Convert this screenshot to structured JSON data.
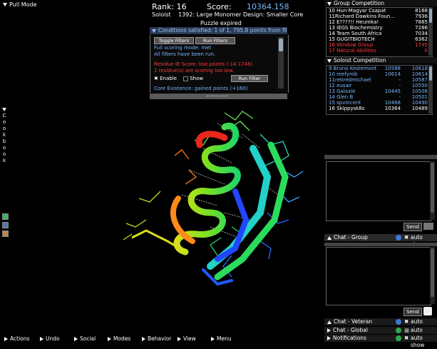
{
  "header": {
    "pull_mode": "Pull Mode",
    "rank_label": "Rank: 16",
    "score_label": "Score:",
    "score_value": "10364.158",
    "mode": "Soloist",
    "puzzle_title": "1392: Large Monomer Design: Smaller Core",
    "status": "Puzzle expired"
  },
  "conditions": {
    "header": "Conditions satisfied: 1 of 1, 795.8 points from filters",
    "toggle_filters": "Toggle Filters",
    "run_filters": "Run Filters",
    "line1": "Full scoring mode: met",
    "line2": "All filters have been run.",
    "line3": "Residue IE Score: lost points (-14.1746)",
    "line4": "1 residue(s) are scoring too low.",
    "enable_label": "Enable",
    "show_label": "Show",
    "run_filter": "Run Filter",
    "core_line": "Core Existence: gained points (+160)"
  },
  "sidebar": {
    "cookbook_letters": [
      "C",
      "o",
      "o",
      "k",
      "b",
      "o",
      "o",
      "k"
    ]
  },
  "group_competition": {
    "title": "Group Competition",
    "rows": [
      {
        "rank": "10 Hun-Magyar Csapat",
        "score": "8168",
        "color": "#ffffff"
      },
      {
        "rank": "11Richard Dawkins Foun...",
        "score": "7936",
        "color": "#ffffff"
      },
      {
        "rank": "12 E????!! Heureka!",
        "score": "7885",
        "color": "#ffffff"
      },
      {
        "rank": "13 IEGS Biochemistry",
        "score": "7286",
        "color": "#ffffff"
      },
      {
        "rank": "14 Team South Africa",
        "score": "7034",
        "color": "#ffffff"
      },
      {
        "rank": "15 GUGITBIOTECH",
        "score": "6362",
        "color": "#ffffff"
      },
      {
        "rank": "16 Window Group",
        "score": "1745",
        "color": "#ff3b3b"
      },
      {
        "rank": "17 Natural Abilities",
        "score": "0",
        "color": "#ff3b3b"
      }
    ]
  },
  "soloist_competition": {
    "title": "Soloist Competition",
    "rows": [
      {
        "rank": "9 Bruno Kestemont",
        "s1": "10588",
        "s2": "10618",
        "color": "#7ab7ff"
      },
      {
        "rank": "10 reefyrob",
        "s1": "10614",
        "s2": "10614",
        "color": "#7ab7ff"
      },
      {
        "rank": "11retiredmichael",
        "s1": "-",
        "s2": "10587",
        "color": "#7ab7ff"
      },
      {
        "rank": "12 eusair",
        "s1": "-",
        "s2": "10550",
        "color": "#7ab7ff"
      },
      {
        "rank": "13 Galaxie",
        "s1": "10445",
        "s2": "10508",
        "color": "#7ab7ff"
      },
      {
        "rank": "14 Glen B",
        "s1": "-",
        "s2": "10501",
        "color": "#7ab7ff"
      },
      {
        "rank": "15 spvincent",
        "s1": "10468",
        "s2": "10490",
        "color": "#7ab7ff"
      },
      {
        "rank": "16 Skippysk8s",
        "s1": "10364",
        "s2": "10489",
        "color": "#ffffff"
      }
    ]
  },
  "chat": {
    "send": "Send",
    "group_label": "Chat - Group",
    "veteran_label": "Chat - Veteran",
    "global_label": "Chat - Global",
    "notifications_label": "Notifications",
    "auto_show": "auto show"
  },
  "menu": {
    "items": [
      "Actions",
      "Undo",
      "Social",
      "Modes",
      "Behavior",
      "View",
      "Menu"
    ]
  },
  "colors": {
    "accent_blue": "#7ab7ff",
    "warning_red": "#ff3b3b"
  }
}
